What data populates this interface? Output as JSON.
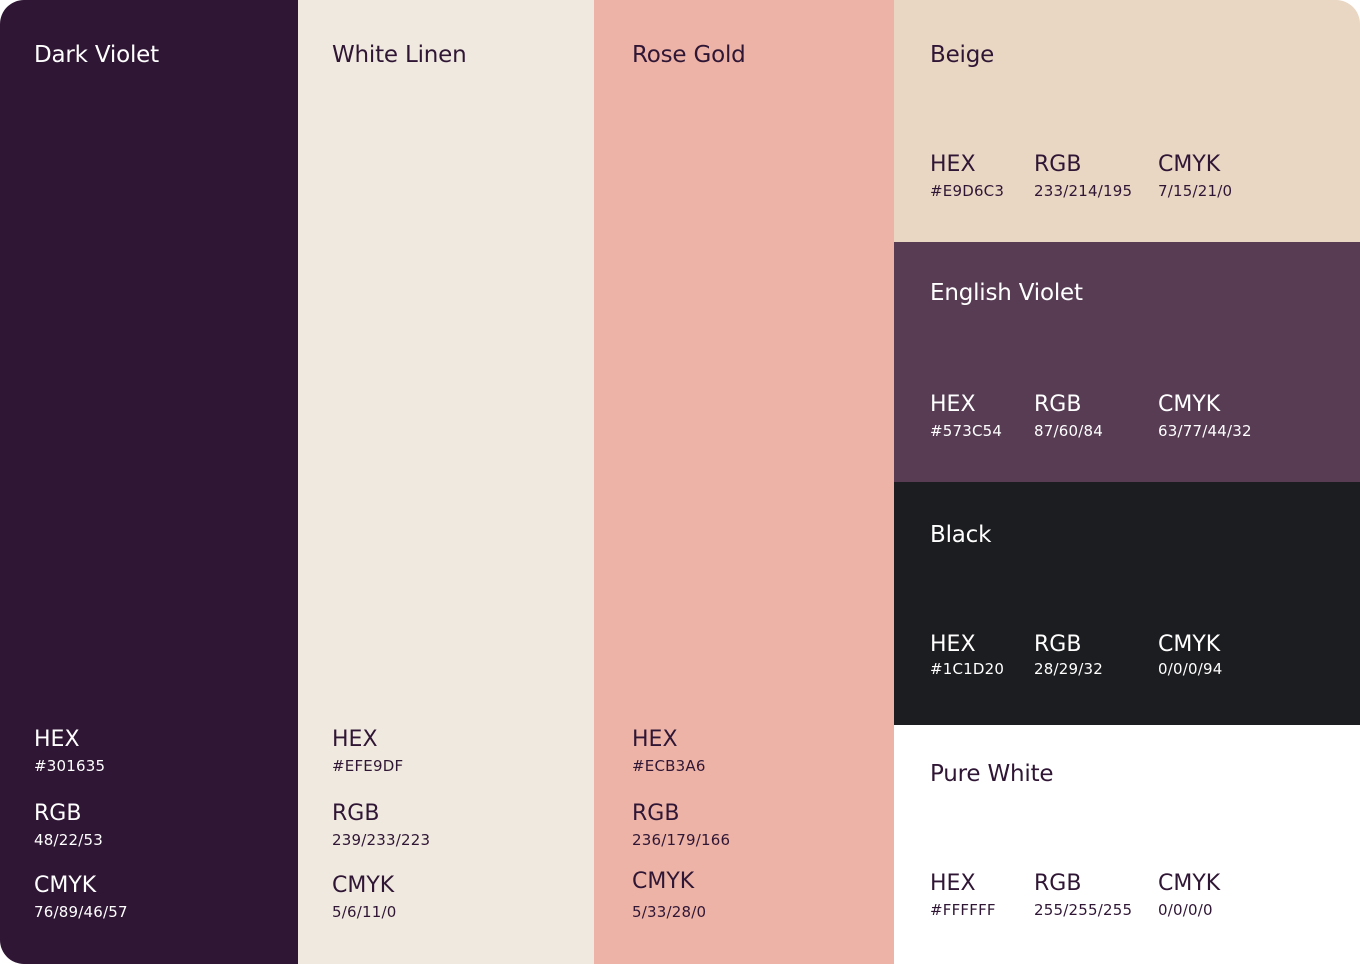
{
  "swatches": [
    {
      "name": "Dark Violet",
      "bg": "#301635",
      "fg": "#ffffff",
      "hex_label": "HEX",
      "hex": "#301635",
      "rgb_label": "RGB",
      "rgb": "48/22/53",
      "cmyk_label": "CMYK",
      "cmyk": "76/89/46/57"
    },
    {
      "name": "White Linen",
      "bg": "#EFE9DF",
      "fg": "#301635",
      "hex_label": "HEX",
      "hex": "#EFE9DF",
      "rgb_label": "RGB",
      "rgb": "239/233/223",
      "cmyk_label": "CMYK",
      "cmyk": "5/6/11/0"
    },
    {
      "name": "Rose Gold",
      "bg": "#ECB3A6",
      "fg": "#301635",
      "hex_label": "HEX",
      "hex": "#ECB3A6",
      "rgb_label": "RGB",
      "rgb": "236/179/166",
      "cmyk_label": "CMYK",
      "cmyk": "5/33/28/0"
    },
    {
      "name": "Beige",
      "bg": "#E9D6C3",
      "fg": "#301635",
      "hex_label": "HEX",
      "hex": "#E9D6C3",
      "rgb_label": "RGB",
      "rgb": "233/214/195",
      "cmyk_label": "CMYK",
      "cmyk": "7/15/21/0"
    },
    {
      "name": "English Violet",
      "bg": "#573C54",
      "fg": "#ffffff",
      "hex_label": "HEX",
      "hex": "#573C54",
      "rgb_label": "RGB",
      "rgb": "87/60/84",
      "cmyk_label": "CMYK",
      "cmyk": "63/77/44/32"
    },
    {
      "name": "Black",
      "bg": "#1C1D20",
      "fg": "#ffffff",
      "hex_label": "HEX",
      "hex": "#1C1D20",
      "rgb_label": "RGB",
      "rgb": "28/29/32",
      "cmyk_label": "CMYK",
      "cmyk": "0/0/0/94"
    },
    {
      "name": "Pure White",
      "bg": "#FFFFFF",
      "fg": "#301635",
      "hex_label": "HEX",
      "hex": "#FFFFFF",
      "rgb_label": "RGB",
      "rgb": "255/255/255",
      "cmyk_label": "CMYK",
      "cmyk": "0/0/0/0"
    }
  ]
}
